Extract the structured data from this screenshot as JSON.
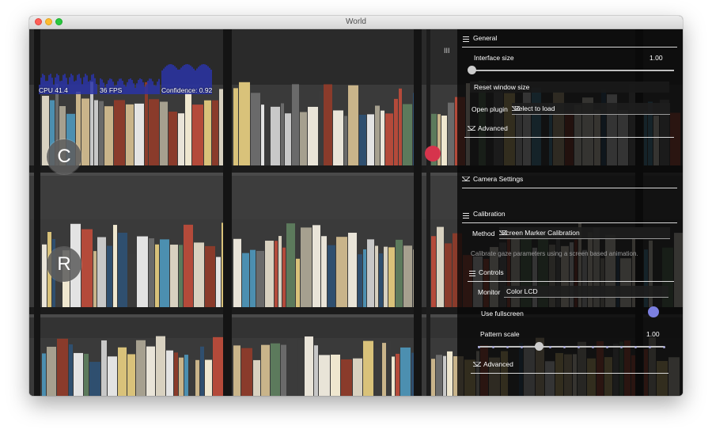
{
  "window": {
    "title": "World"
  },
  "graphs": {
    "cpu_label": "CPU 41.4",
    "fps_label": "36 FPS",
    "confidence_label": "Confidence: 0.92",
    "bar_color": "#2a34a6"
  },
  "buttons": {
    "calibrate_label": "C",
    "record_label": "R"
  },
  "panel": {
    "menu_handle": "III",
    "general": {
      "header": "General",
      "interface_size_label": "Interface size",
      "interface_size_value": "1.00",
      "reset_window_label": "Reset window size",
      "open_plugin_label": "Open plugin",
      "open_plugin_value": "Select to load",
      "advanced_label": "Advanced"
    },
    "camera": {
      "header": "Camera Settings"
    },
    "calibration": {
      "header": "Calibration",
      "method_label": "Method",
      "method_value": "Screen Marker Calibration",
      "description": "Calibrate gaze parameters using a screen based animation.",
      "controls_header": "Controls",
      "monitor_label": "Monitor",
      "monitor_value": "Color LCD",
      "fullscreen_label": "Use fullscreen",
      "fullscreen_on": true,
      "pattern_scale_label": "Pattern scale",
      "pattern_scale_value": "1.00",
      "advanced_label": "Advanced"
    },
    "accent_color": "#7b7fe0",
    "gaze_color": "#d6344c"
  }
}
